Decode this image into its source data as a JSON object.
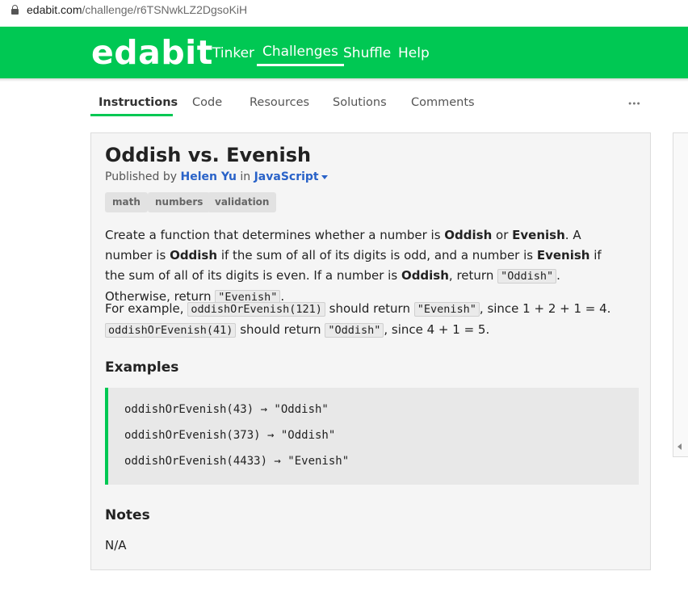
{
  "browser": {
    "url_domain": "edabit.com",
    "url_path": "/challenge/r6TSNwkLZ2DgsoKiH"
  },
  "header": {
    "logo": "edabit",
    "nav": [
      "Tinker",
      "Challenges",
      "Shuffle",
      "Help"
    ],
    "active_nav": "Challenges",
    "color": "#00c853"
  },
  "tabs": {
    "items": [
      "Instructions",
      "Code",
      "Resources",
      "Solutions",
      "Comments"
    ],
    "active": "Instructions",
    "more_icon": "more-dots-icon"
  },
  "challenge": {
    "title": "Oddish vs. Evenish",
    "published_by_prefix": "Published by",
    "author": "Helen Yu",
    "in_text": "in",
    "language": "JavaScript",
    "tags": [
      "math",
      "numbers",
      "validation"
    ],
    "description": {
      "p1_a": "Create a function that determines whether a number is ",
      "oddish": "Oddish",
      "p1_or": " or ",
      "evenish": "Evenish",
      "p1_b": ". A number is ",
      "p1_c": " if the sum of all of its digits is odd, and a number is ",
      "p1_d": " if the sum of all of its digits is even. If a number is ",
      "p1_e": ", return ",
      "code_oddish": "\"Oddish\"",
      "p1_f": ". Otherwise, return ",
      "code_evenish": "\"Evenish\"",
      "p1_g": ".",
      "p2_a": "For example, ",
      "code_ex1": "oddishOrEvenish(121)",
      "p2_b": " should return ",
      "p2_c": ", since 1 + 2 + 1 = 4.",
      "code_ex2": "oddishOrEvenish(41)",
      "p2_d": " should return ",
      "p2_e": ", since 4 + 1 = 5."
    },
    "examples_heading": "Examples",
    "examples": [
      "oddishOrEvenish(43) → \"Oddish\"",
      "oddishOrEvenish(373) → \"Oddish\"",
      "oddishOrEvenish(4433) → \"Evenish\""
    ],
    "notes_heading": "Notes",
    "notes": "N/A"
  }
}
